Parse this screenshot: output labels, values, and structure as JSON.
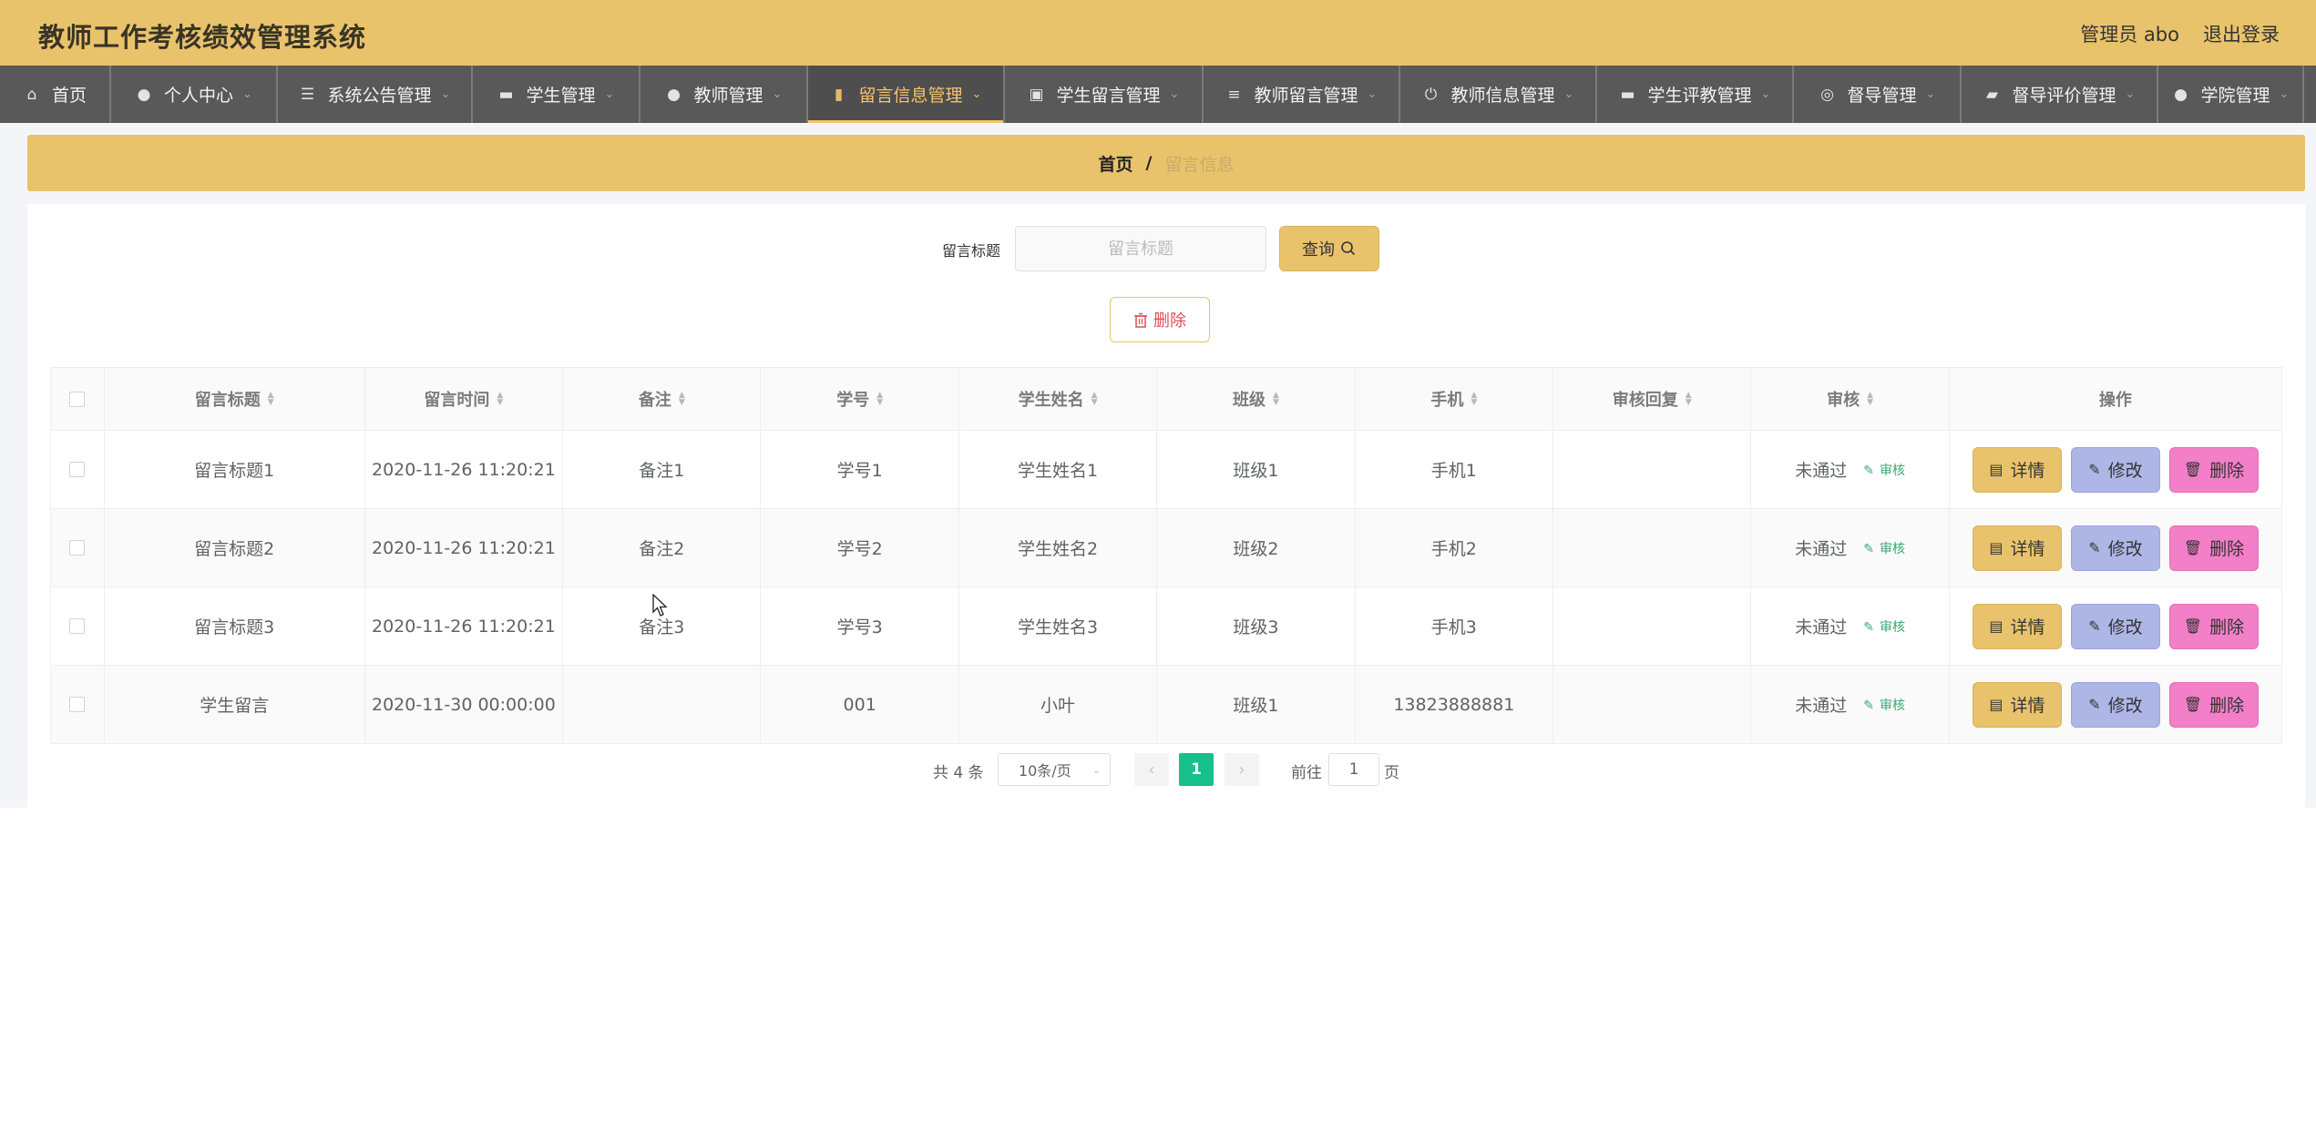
{
  "header": {
    "title": "教师工作考核绩效管理系统",
    "user_label": "管理员 abo",
    "logout_label": "退出登录"
  },
  "nav": {
    "items": [
      {
        "label": "首页",
        "icon": "home-icon",
        "caret": false
      },
      {
        "label": "个人中心",
        "icon": "user-icon",
        "caret": true
      },
      {
        "label": "系统公告管理",
        "icon": "sliders-icon",
        "caret": true
      },
      {
        "label": "学生管理",
        "icon": "chat-icon",
        "caret": true
      },
      {
        "label": "教师管理",
        "icon": "location-icon",
        "caret": true
      },
      {
        "label": "留言信息管理",
        "icon": "bar-chart-icon",
        "caret": true,
        "active": true
      },
      {
        "label": "学生留言管理",
        "icon": "clipboard-icon",
        "caret": true
      },
      {
        "label": "教师留言管理",
        "icon": "list-icon",
        "caret": true
      },
      {
        "label": "教师信息管理",
        "icon": "power-icon",
        "caret": true
      },
      {
        "label": "学生评教管理",
        "icon": "monitor-icon",
        "caret": true
      },
      {
        "label": "督导管理",
        "icon": "globe-icon",
        "caret": true
      },
      {
        "label": "督导评价管理",
        "icon": "camera-icon",
        "caret": true
      },
      {
        "label": "学院管理",
        "icon": "person-icon",
        "caret": true
      }
    ]
  },
  "breadcrumb": {
    "home": "首页",
    "separator": "/",
    "current": "留言信息"
  },
  "search": {
    "label": "留言标题",
    "placeholder": "留言标题",
    "query_label": "查询",
    "delete_label": "删除"
  },
  "table": {
    "columns": [
      "留言标题",
      "留言时间",
      "备注",
      "学号",
      "学生姓名",
      "班级",
      "手机",
      "审核回复",
      "审核",
      "操作"
    ],
    "rows": [
      {
        "title": "留言标题1",
        "time": "2020-11-26 11:20:21",
        "remark": "备注1",
        "student_no": "学号1",
        "student_name": "学生姓名1",
        "class": "班级1",
        "phone": "手机1",
        "reply": "",
        "status": "未通过"
      },
      {
        "title": "留言标题2",
        "time": "2020-11-26 11:20:21",
        "remark": "备注2",
        "student_no": "学号2",
        "student_name": "学生姓名2",
        "class": "班级2",
        "phone": "手机2",
        "reply": "",
        "status": "未通过"
      },
      {
        "title": "留言标题3",
        "time": "2020-11-26 11:20:21",
        "remark": "备注3",
        "student_no": "学号3",
        "student_name": "学生姓名3",
        "class": "班级3",
        "phone": "手机3",
        "reply": "",
        "status": "未通过"
      },
      {
        "title": "学生留言",
        "time": "2020-11-30 00:00:00",
        "remark": "",
        "student_no": "001",
        "student_name": "小叶",
        "class": "班级1",
        "phone": "13823888881",
        "reply": "",
        "status": "未通过"
      }
    ],
    "audit_label": "审核",
    "detail_label": "详情",
    "edit_label": "修改",
    "delete_label": "删除"
  },
  "pagination": {
    "total_text": "共 4 条",
    "page_size": "10条/页",
    "current_page": "1",
    "goto_prefix": "前往",
    "goto_value": "1",
    "goto_suffix": "页"
  },
  "colors": {
    "accent": "#e8c36c",
    "nav_bg": "#595959",
    "active_nav": "#f3c46a",
    "edit_btn": "#aeb6e6",
    "delete_btn": "#f27fc8",
    "page_active": "#16c08a"
  }
}
